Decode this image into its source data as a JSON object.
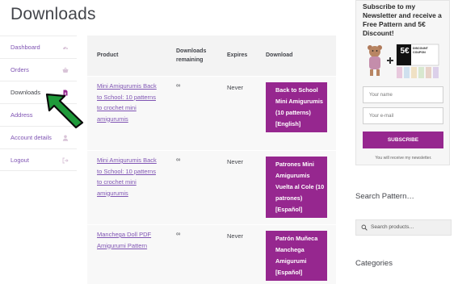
{
  "page": {
    "title": "Downloads"
  },
  "nav": {
    "items": [
      {
        "label": "Dashboard",
        "icon": "dashboard-icon"
      },
      {
        "label": "Orders",
        "icon": "basket-icon"
      },
      {
        "label": "Downloads",
        "icon": "file-download-icon"
      },
      {
        "label": "Address",
        "icon": "home-icon"
      },
      {
        "label": "Account details",
        "icon": "user-icon"
      },
      {
        "label": "Logout",
        "icon": "logout-icon"
      }
    ]
  },
  "table": {
    "headers": {
      "product": "Product",
      "remaining": "Downloads remaining",
      "expires": "Expires",
      "download": "Download"
    },
    "rows": [
      {
        "product": "Mini Amigurumis Back to School: 10 patterns to crochet mini amigurumis",
        "remaining": "∞",
        "expires": "Never",
        "download": "Back to School Mini Amigurumis (10 patterns) [English]"
      },
      {
        "product": "Mini Amigurumis Back to School: 10 patterns to crochet mini amigurumis",
        "remaining": "∞",
        "expires": "Never",
        "download": "Patrones Mini Amigurumis Vuelta al Cole (10 patrones) [Español]"
      },
      {
        "product": "Manchega Doll PDF Amigurumi Pattern",
        "remaining": "∞",
        "expires": "Never",
        "download": "Patrón Muñeca Manchega Amigurumi [Español]"
      }
    ]
  },
  "promo": {
    "title": "Subscribe to my Newsletter and receive a Free Pattern and 5€ Discount!",
    "coupon_amount": "5€",
    "coupon_label": "DISCOUNT COUPON",
    "name_placeholder": "Your name",
    "email_placeholder": "Your e-mail",
    "subscribe_label": "SUBSCRIBE",
    "note": "You will receive my newsletter."
  },
  "sidebar": {
    "search_heading": "Search Pattern…",
    "search_placeholder": "Search products…",
    "categories_heading": "Categories"
  },
  "colors": {
    "accent": "#96278f",
    "link": "#7f54b3",
    "arrow": "#1f9a3a"
  }
}
